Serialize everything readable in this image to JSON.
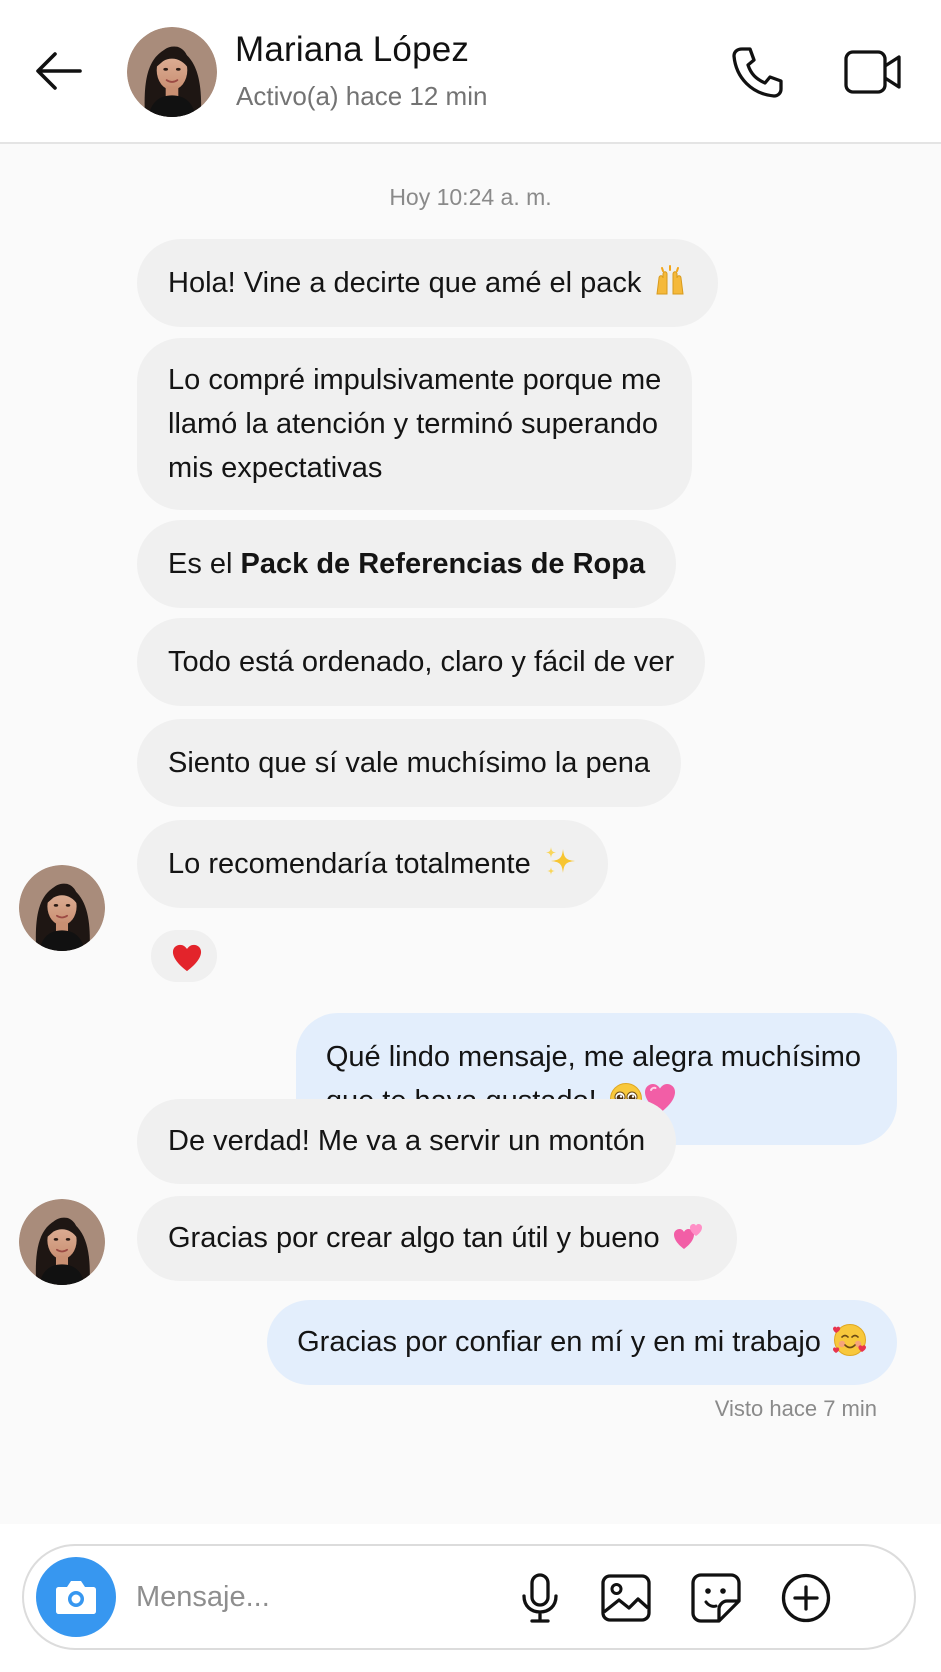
{
  "header": {
    "contact_name": "Mariana López",
    "status": "Activo(a) hace 12 min"
  },
  "chat": {
    "timestamp": "Hoy 10:24 a. m.",
    "messages": [
      {
        "from": "them",
        "text": "Hola! Vine a decirte que amé el pack",
        "emoji": "raising-hands-emoji"
      },
      {
        "from": "them",
        "lines": [
          "Lo compré impulsivamente porque me",
          "llamó la atención y terminó superando",
          "mis expectativas"
        ]
      },
      {
        "from": "them",
        "text": "Es el ",
        "bold": "Pack de Referencias de Ropa"
      },
      {
        "from": "them",
        "text": "Todo está ordenado, claro y fácil de ver"
      },
      {
        "from": "them",
        "text": "Siento que sí vale muchísimo la pena"
      },
      {
        "from": "them",
        "text": "Lo recomendaría totalmente",
        "emoji": "sparkles-emoji",
        "reaction": "heart-emoji"
      },
      {
        "from": "me",
        "lines": [
          "Qué lindo mensaje, me alegra muchísimo",
          "que te haya gustado!"
        ],
        "emoji": [
          "pleading-face-emoji",
          "pink-heart-emoji"
        ]
      },
      {
        "from": "them",
        "text": "De verdad! Me va a servir un montón"
      },
      {
        "from": "them",
        "text": "Gracias por crear algo tan útil y bueno",
        "emoji": "two-hearts-emoji"
      },
      {
        "from": "me",
        "text": "Gracias por confiar en mí y en mi trabajo",
        "emoji": "smiling-face-with-hearts-emoji"
      }
    ],
    "seen_status": "Visto hace 7 min"
  },
  "composer": {
    "placeholder": "Mensaje...",
    "value": ""
  },
  "icons": {
    "back": "arrow-left-icon",
    "call": "phone-icon",
    "video": "video-camera-icon",
    "camera": "camera-icon",
    "mic": "microphone-icon",
    "gallery": "image-icon",
    "sticker": "sticker-icon",
    "more": "plus-circle-icon"
  },
  "colors": {
    "incoming_bubble": "#f0f0f0",
    "outgoing_bubble": "#e3eefc",
    "accent": "#3797f0",
    "secondary_text": "#8a8a8a"
  }
}
